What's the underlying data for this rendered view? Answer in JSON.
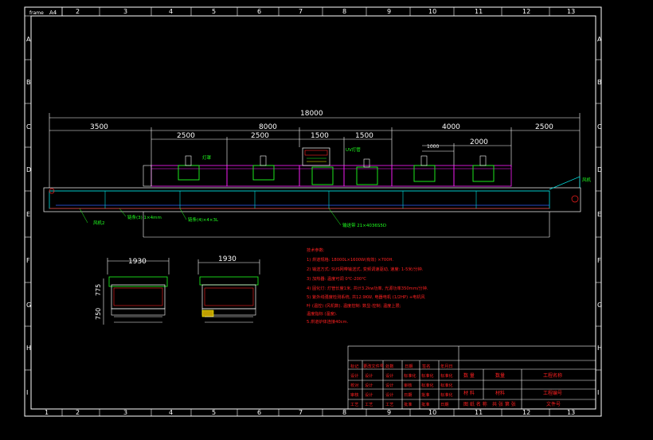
{
  "sheet": {
    "size_label": "A4",
    "corner_tag": "frame",
    "columns": [
      "1",
      "2",
      "3",
      "4",
      "5",
      "6",
      "7",
      "8",
      "9",
      "10",
      "11",
      "12",
      "13"
    ],
    "rows": [
      "A",
      "B",
      "C",
      "D",
      "E",
      "F",
      "G",
      "H",
      "I"
    ]
  },
  "dims": {
    "overall": "18000",
    "d3500": "3500",
    "d8000": "8000",
    "d4000": "4000",
    "d2500_left": "2500",
    "d2500_mid": "2500",
    "d1500_a": "1500",
    "d1500_b": "1500",
    "d2500_right": "2500",
    "d1000": "1000",
    "d2000": "2000",
    "section1_width": "1930",
    "section2_width": "1930",
    "h775": "775",
    "h750": "750"
  },
  "labels": {
    "uv_lamp": "UV灯管",
    "lamp_left": "灯罩",
    "lamp_right": "风机",
    "callout1": "风机2",
    "callout2": "链条(3) 1×4mm",
    "callout3": "链条(4)×4×3L",
    "callout4": "输送带 21×4036S5D"
  },
  "notes": [
    "技术参数:",
    "1) 烘道规格: 18000L×1600W(有效) ×700H.",
    "2) 输送方式: SUS网带输送式, 变频调速驱动, 速度: 1-5米/分钟.",
    "3) 加热器: 温度可调 0℃-200℃",
    "4) 固化灯: 灯管长度1米, 共计3.2kw功率, 光源功率350mm/分钟.",
    "5) 紫外线强度检测系统, 共12.9KW, 电器电机 (1/2HP) +电机风",
    "叶 (温控) (风机数). 温度控制: 数显-控制; 温度上限;",
    "温度指标 (温度).",
    "5.烘道炉体连接40cm."
  ],
  "title_block": {
    "rev_headers": [
      "标记",
      "更改文件号",
      "处数",
      "日期",
      "签名",
      "年月日"
    ],
    "rows": [
      [
        "设计",
        "设计",
        "设计",
        "标准化",
        "标准化",
        "标准化"
      ],
      [
        "校对",
        "设计",
        "设计",
        "审核",
        "标准化",
        "标准化"
      ],
      [
        "审核",
        "设计",
        "设计",
        "日期",
        "批准",
        "标准化"
      ],
      [
        "工艺",
        "工艺",
        "工艺",
        "批准",
        "批准",
        "日期"
      ]
    ],
    "quantity_label": "数 量",
    "quantity_value": "数量",
    "material_label": "材 料",
    "material_value": "材料",
    "project_name": "工程名称",
    "drawing_no": "工程编号",
    "drawing_title": "图 纸 名 称",
    "scale_label": "共 张 第 张",
    "doc_no": "文件号"
  },
  "colors": {
    "background": "#000000",
    "frame": "#ffffff",
    "dimension": "#ffffff",
    "conveyor": "#00e0e0",
    "red": "#ff2020",
    "magenta": "#ff20ff",
    "green": "#20ff20",
    "blue": "#3060ff",
    "yellow": "#ffff00"
  }
}
